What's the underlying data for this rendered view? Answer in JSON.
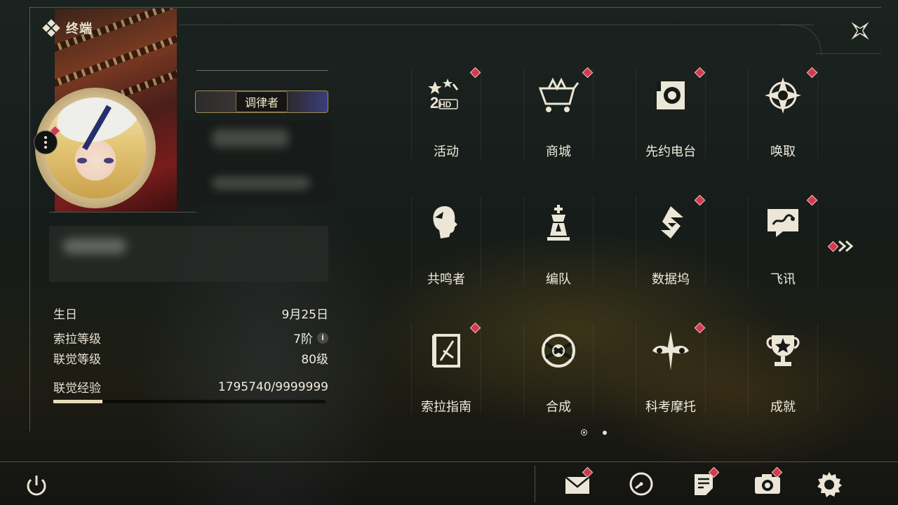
{
  "header": {
    "title": "终端"
  },
  "profile": {
    "rank_label": "调律者",
    "stats": [
      {
        "label": "生日",
        "value": "9月25日"
      },
      {
        "label": "索拉等级",
        "value": "7阶"
      },
      {
        "label": "联觉等级",
        "value": "80级"
      }
    ],
    "exp": {
      "label": "联觉经验",
      "value": "1795740/9999999",
      "progress": 0.1796
    }
  },
  "menu": {
    "items": [
      {
        "label": "活动",
        "icon": "event-2hd-icon",
        "badge": true
      },
      {
        "label": "商城",
        "icon": "shop-basket-icon",
        "badge": true
      },
      {
        "label": "先约电台",
        "icon": "radio-icon",
        "badge": true
      },
      {
        "label": "唤取",
        "icon": "summon-star-icon",
        "badge": true
      },
      {
        "label": "共鸣者",
        "icon": "resonator-head-icon",
        "badge": false
      },
      {
        "label": "编队",
        "icon": "team-chess-icon",
        "badge": false
      },
      {
        "label": "数据坞",
        "icon": "data-bank-icon",
        "badge": true
      },
      {
        "label": "飞讯",
        "icon": "chat-icon",
        "badge": true
      },
      {
        "label": "索拉指南",
        "icon": "guide-icon",
        "badge": true
      },
      {
        "label": "合成",
        "icon": "synthesis-icon",
        "badge": false
      },
      {
        "label": "科考摩托",
        "icon": "motorcycle-icon",
        "badge": true
      },
      {
        "label": "成就",
        "icon": "trophy-icon",
        "badge": false
      }
    ],
    "pages": 2,
    "current_page": 1
  },
  "bottom_bar": [
    {
      "icon": "mail-icon",
      "badge": true
    },
    {
      "icon": "clock-icon",
      "badge": false
    },
    {
      "icon": "notes-icon",
      "badge": true
    },
    {
      "icon": "camera-icon",
      "badge": true
    },
    {
      "icon": "settings-gear-icon",
      "badge": false
    }
  ],
  "colors": {
    "badge": "#d23a4e",
    "accent": "#e0c892",
    "text": "#e8e2d2"
  }
}
